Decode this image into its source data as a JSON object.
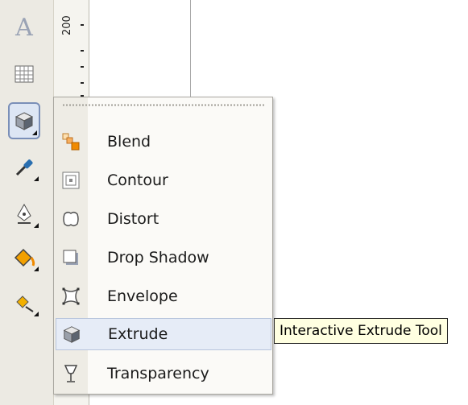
{
  "ruler": {
    "label": "200"
  },
  "toolbox": {
    "tools": [
      {
        "name": "text-tool",
        "icon": "text-A-icon"
      },
      {
        "name": "table-tool",
        "icon": "table-icon"
      },
      {
        "name": "interactive-tools",
        "icon": "extrude-cube-icon",
        "active": true
      },
      {
        "name": "eyedropper-tool",
        "icon": "eyedropper-icon"
      },
      {
        "name": "outline-tool",
        "icon": "pen-nib-icon"
      },
      {
        "name": "fill-tool",
        "icon": "paint-bucket-icon"
      },
      {
        "name": "interactive-fill-tool",
        "icon": "interactive-fill-icon"
      }
    ]
  },
  "menu": {
    "items": [
      {
        "label": "Blend",
        "icon": "blend-icon"
      },
      {
        "label": "Contour",
        "icon": "contour-icon"
      },
      {
        "label": "Distort",
        "icon": "distort-icon"
      },
      {
        "label": "Drop Shadow",
        "icon": "drop-shadow-icon"
      },
      {
        "label": "Envelope",
        "icon": "envelope-icon"
      },
      {
        "label": "Extrude",
        "icon": "extrude-icon",
        "highlighted": true
      },
      {
        "label": "Transparency",
        "icon": "transparency-icon"
      }
    ]
  },
  "tooltip": {
    "text": "Interactive Extrude Tool"
  },
  "colors": {
    "accent": "#f08a00",
    "highlight": "#e6ecf7",
    "tooltip_bg": "#ffffe1"
  }
}
